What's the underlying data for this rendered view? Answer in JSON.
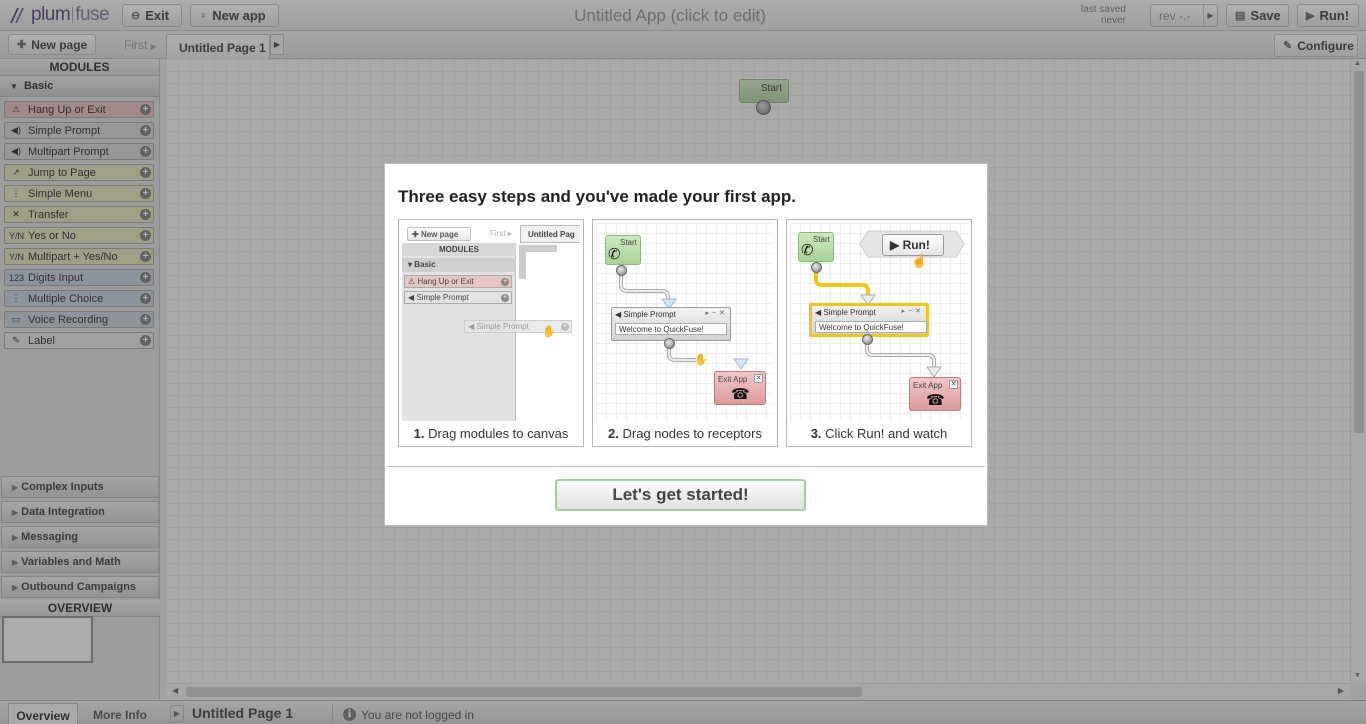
{
  "topbar": {
    "logo_plum": "plum",
    "logo_fuse": "fuse",
    "exit_label": "Exit",
    "new_app_label": "New app",
    "app_title": "Untitled App (click to edit)",
    "last_saved_line1": "last saved",
    "last_saved_line2": "never",
    "rev_label": "rev -.-",
    "save_label": "Save",
    "run_label": "Run!"
  },
  "pagebar": {
    "new_page_label": "New page",
    "first_label": "First",
    "page_tab_label": "Untitled Page 1",
    "configure_label": "Configure"
  },
  "sidebar": {
    "modules_header": "MODULES",
    "basic_label": "Basic",
    "modules": [
      {
        "label": "Hang Up or Exit",
        "icon": "warning-icon",
        "glyph": "⚠",
        "color": "#e9c6c6"
      },
      {
        "label": "Simple Prompt",
        "icon": "speaker-icon",
        "glyph": "◀)",
        "color": "#dadada"
      },
      {
        "label": "Multipart Prompt",
        "icon": "speaker-icon",
        "glyph": "◀)",
        "color": "#dadada"
      },
      {
        "label": "Jump to Page",
        "icon": "jump-icon",
        "glyph": "↗",
        "color": "#e6e6c0"
      },
      {
        "label": "Simple Menu",
        "icon": "menu-icon",
        "glyph": "⋮",
        "color": "#e6e6c0"
      },
      {
        "label": "Transfer",
        "icon": "transfer-icon",
        "glyph": "✕",
        "color": "#e6e6c0"
      },
      {
        "label": "Yes or No",
        "icon": "yes-no-icon",
        "glyph": "Y/N",
        "color": "#e6e6c0"
      },
      {
        "label": "Multipart + Yes/No",
        "icon": "yes-no-icon",
        "glyph": "Y/N",
        "color": "#e6e6c0"
      },
      {
        "label": "Digits Input",
        "icon": "digits-icon",
        "glyph": "123",
        "color": "#ccd5e2"
      },
      {
        "label": "Multiple Choice",
        "icon": "choice-icon",
        "glyph": "⋮",
        "color": "#ccd5e2"
      },
      {
        "label": "Voice Recording",
        "icon": "recording-icon",
        "glyph": "▭",
        "color": "#ccd5e2"
      },
      {
        "label": "Label",
        "icon": "pin-icon",
        "glyph": "✎",
        "color": "#e6e6e6"
      }
    ],
    "groups": [
      "Complex Inputs",
      "Data Integration",
      "Messaging",
      "Variables and Math",
      "Outbound Campaigns"
    ],
    "overview_header": "OVERVIEW"
  },
  "canvas": {
    "start_label": "Start"
  },
  "statusbar": {
    "overview_tab": "Overview",
    "more_info_tab": "More Info",
    "page_label": "Untitled Page 1",
    "login_text": "You are not logged in"
  },
  "modal": {
    "title": "Three easy steps and you've made your first app.",
    "steps": [
      {
        "num": "1.",
        "caption": "Drag modules to canvas"
      },
      {
        "num": "2.",
        "caption": "Drag nodes to receptors"
      },
      {
        "num": "3.",
        "caption": "Click Run! and watch"
      }
    ],
    "mini": {
      "new_page": "New page",
      "first": "First",
      "page_tab": "Untitled Pag",
      "modules": "MODULES",
      "basic": "Basic",
      "hang_up": "Hang Up or Exit",
      "simple_prompt": "Simple Prompt",
      "start": "Start",
      "welcome": "Welcome to QuickFuse!",
      "exit_app": "Exit App",
      "run": "Run!"
    },
    "cta_label": "Let's get started!"
  }
}
